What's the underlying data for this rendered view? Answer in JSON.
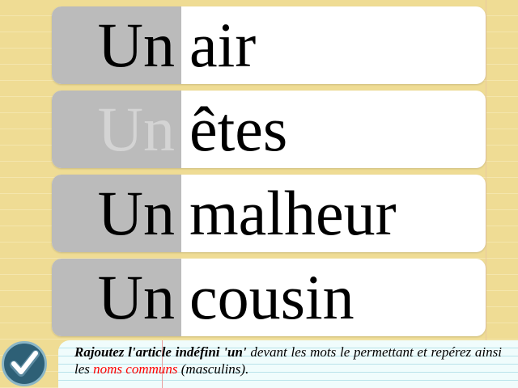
{
  "rows": [
    {
      "article": "Un",
      "word": "air",
      "article_state": "shown"
    },
    {
      "article": "Un",
      "word": "êtes",
      "article_state": "faded"
    },
    {
      "article": "Un",
      "word": "malheur",
      "article_state": "shown"
    },
    {
      "article": "Un",
      "word": "cousin",
      "article_state": "shown"
    }
  ],
  "instructions": {
    "part1_bold": "Rajoutez l'article indéfini 'un'",
    "part2": " devant les mots le permettant et repérez ainsi les ",
    "part3_red": "noms communs",
    "part4": " (masculins)."
  },
  "colors": {
    "background": "#efdc94",
    "article_bg": "#bbbbbb",
    "highlight": "#ff0000",
    "check_button": "#2e6076"
  },
  "icons": {
    "check_button": "checkmark-icon"
  }
}
